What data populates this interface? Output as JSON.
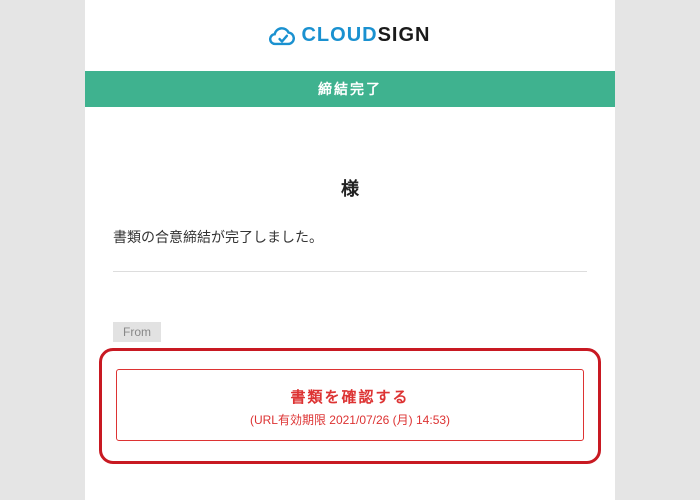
{
  "logo": {
    "cloud": "CLOUD",
    "sign": "SIGN"
  },
  "status_bar": "締結完了",
  "recipient_suffix": "様",
  "message": "書類の合意締結が完了しました。",
  "from_label": "From",
  "cta": {
    "title": "書類を確認する",
    "subtitle": "(URL有効期限 2021/07/26 (月) 14:53)"
  },
  "colors": {
    "accent_green": "#3fb28f",
    "accent_blue": "#1a91d0",
    "highlight_red": "#c81922",
    "button_red": "#d33"
  }
}
